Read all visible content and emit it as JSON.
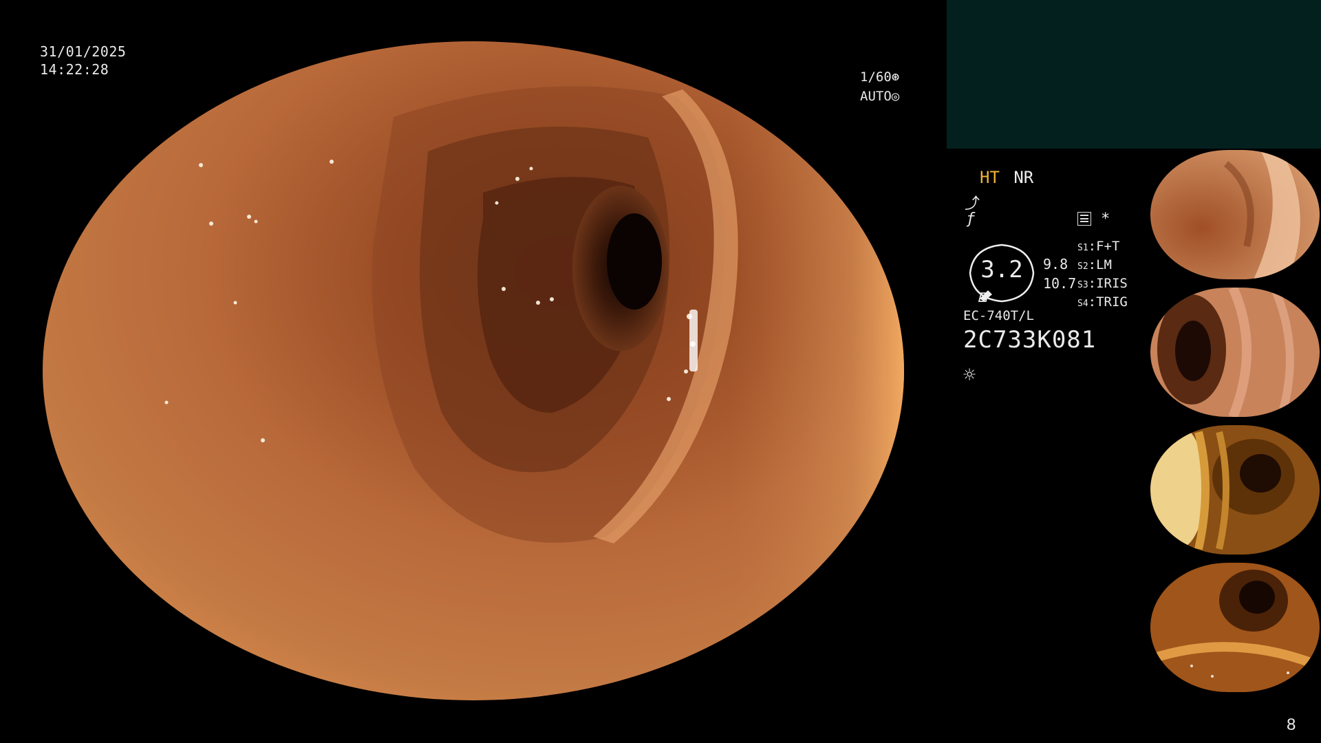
{
  "overlay": {
    "date": "31/01/2025",
    "time": "14:22:28",
    "shutter": "1/60",
    "iris_mode": "AUTO",
    "page_number": "8"
  },
  "status": {
    "ht_label": "HT",
    "nr_label": "NR",
    "gauge_value": "3.2",
    "side_value_1": "9.8",
    "side_value_2": "10.7",
    "switches": [
      {
        "key": "S1",
        "value": "F+T"
      },
      {
        "key": "S2",
        "value": "LM"
      },
      {
        "key": "S3",
        "value": "IRIS"
      },
      {
        "key": "S4",
        "value": "TRIG"
      }
    ],
    "scope_model": "EC-740T/L",
    "scope_serial": "2C733K081",
    "asterisk": "*"
  },
  "colors": {
    "accent_yellow": "#f2b335",
    "tissue_base": "#b8693a",
    "panel_band": "#03201f"
  },
  "icons": [
    "shutter-icon",
    "iris-icon",
    "enhance-curve-icon",
    "frequency-icon",
    "memory-icon",
    "light-icon"
  ]
}
